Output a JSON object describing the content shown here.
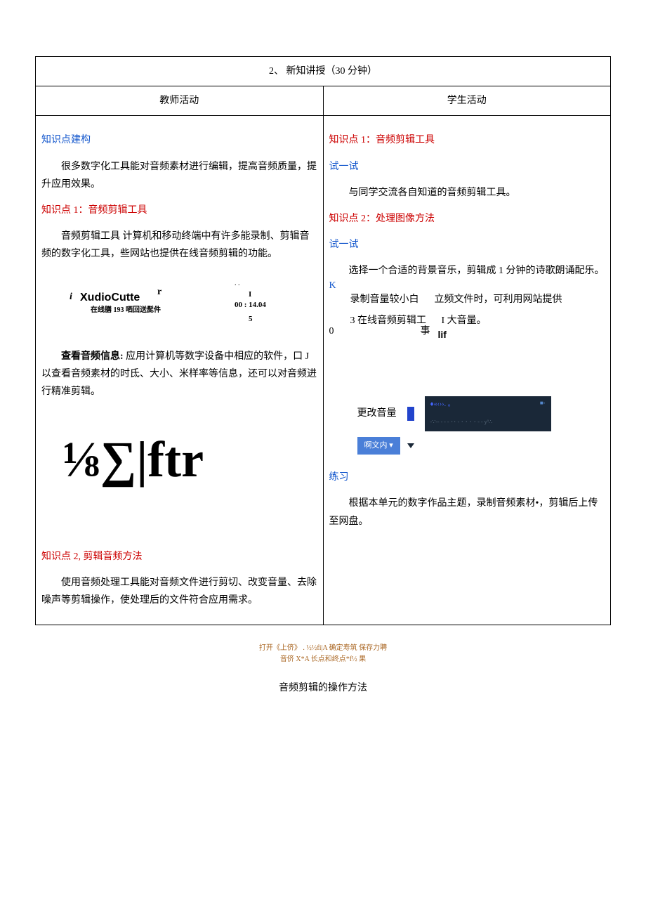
{
  "section": {
    "number": "2、",
    "title": "新知讲授（30 分钟）"
  },
  "cols": {
    "left_header": "教师活动",
    "right_header": "学生活动"
  },
  "left": {
    "build_heading": "知识点建构",
    "intro": "很多数字化工具能对音频素材进行编辑，提高音频质量，提升应用效果。",
    "k1_heading": "知识点 1：音频剪辑工具",
    "k1_body": "音频剪辑工具 计算机和移动终端中有许多能录制、剪辑音频的数字化工具，些网站也提供在线音频剪辑的功能。",
    "audio_cutter": {
      "i_mark": "i",
      "name": "XudioCutte",
      "r_mark": "r",
      "sub": "在线膳 193 哂回送髭件",
      "dots": ". .",
      "time_i": "I",
      "time": "00 : 14.04",
      "five": "5"
    },
    "view_info_label": "查看音频信息:",
    "view_info_body": " 应用计算机等数字设备中相应的软件，口 J 以查看音频素材的时氐、大小、米样率等信息，还可以对音频进行精准剪辑。",
    "formula": "⅛∑|ftr",
    "k2_heading": "知识点 2, 剪辑音频方法",
    "k2_body": "使用音频处理工具能对音频文件进行剪切、改变音量、去除噪声等剪辑操作，使处理后的文件符合应用需求。",
    "flow": {
      "line1": "打开《上侪》 .     ½½fi|A 确定寿筑                保存力聘",
      "line2": "音侪                X*A 长点和终点*f½ 果"
    },
    "method_caption": "音频剪辑的操作方法"
  },
  "right": {
    "k1_heading": "知识点 1：音频剪辑工具",
    "try1": "试一试",
    "try1_body": "与同学交流各自知道的音频剪辑工具。",
    "k2_heading": "知识点 2：处理图像方法",
    "try2": "试一试",
    "try2_body": "选择一个合适的背景音乐，剪辑成 1 分钟的诗歌朗诵配乐。",
    "block": {
      "k": "K",
      "l1a": "录制音量较小白",
      "l1b": "立频文件时，可利用网站提供",
      "l2a": "3 在线音频剪辑工",
      "l2b": "I 大音量。",
      "zero": "0",
      "shi": "事",
      "lif": "lif"
    },
    "volume_label": "更改音量",
    "panel": {
      "sym1": "♦«‹››. 。",
      "sym2": "■◦",
      "dots": "-∵-- - - - ･･ - ･ ･ ･ ･ - - yº∴"
    },
    "blue_btn": "啊文内  ▾",
    "practice_heading": "练习",
    "practice_body": "根据本单元的数字作品主题，录制音频素材•，剪辑后上传至网盘。"
  }
}
